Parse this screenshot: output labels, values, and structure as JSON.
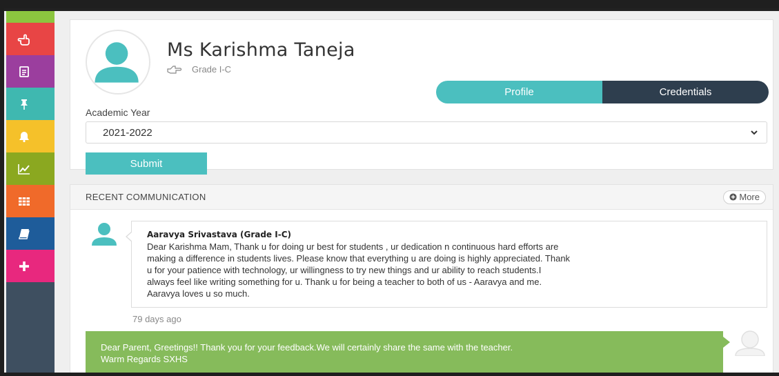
{
  "sidebar": {
    "items": [
      {
        "icon": "pointing-hand-icon",
        "color": "#e84545"
      },
      {
        "icon": "document-icon",
        "color": "#9b3e9e"
      },
      {
        "icon": "pin-icon",
        "color": "#3fb8b0"
      },
      {
        "icon": "bell-icon",
        "color": "#f5c12a"
      },
      {
        "icon": "chart-line-icon",
        "color": "#8ba820"
      },
      {
        "icon": "grid-icon",
        "color": "#f06a2a"
      },
      {
        "icon": "book-icon",
        "color": "#1e5c9a"
      },
      {
        "icon": "plus-icon",
        "color": "#e8287e"
      }
    ],
    "background": "#3e4f60",
    "top_accent": "#8cc63f"
  },
  "profile": {
    "name": "Ms Karishma Taneja",
    "grade": "Grade I-C",
    "tabs": [
      {
        "label": "Profile",
        "active": true
      },
      {
        "label": "Credentials",
        "active": false
      }
    ],
    "academic_year_label": "Academic Year",
    "academic_year_value": "2021-2022",
    "submit_label": "Submit"
  },
  "communication": {
    "title": "RECENT COMMUNICATION",
    "more_label": "More",
    "message": {
      "sender": "Aaravya Srivastava (Grade I-C)",
      "lines": [
        "Dear Karishma Mam, Thank u for doing ur best for students , ur dedication n continuous hard efforts are",
        "making a difference in students lives. Please know that everything u are doing is highly appreciated. Thank",
        "u for your patience with technology, ur willingness to try new things and ur ability to reach students.I",
        "always feel like writing something for u. Thank u for being a teacher to both of us - Aaravya and me.",
        "Aaravya loves u so much."
      ],
      "time": "79 days ago"
    },
    "reply": {
      "lines": [
        "Dear Parent, Greetings!! Thank you for your feedback.We will certainly share the same with the teacher.",
        "Warm Regards SXHS"
      ]
    }
  },
  "colors": {
    "teal": "#4bbfbf",
    "dark_navy": "#2e3e4e",
    "reply_green": "#86bb5b"
  }
}
